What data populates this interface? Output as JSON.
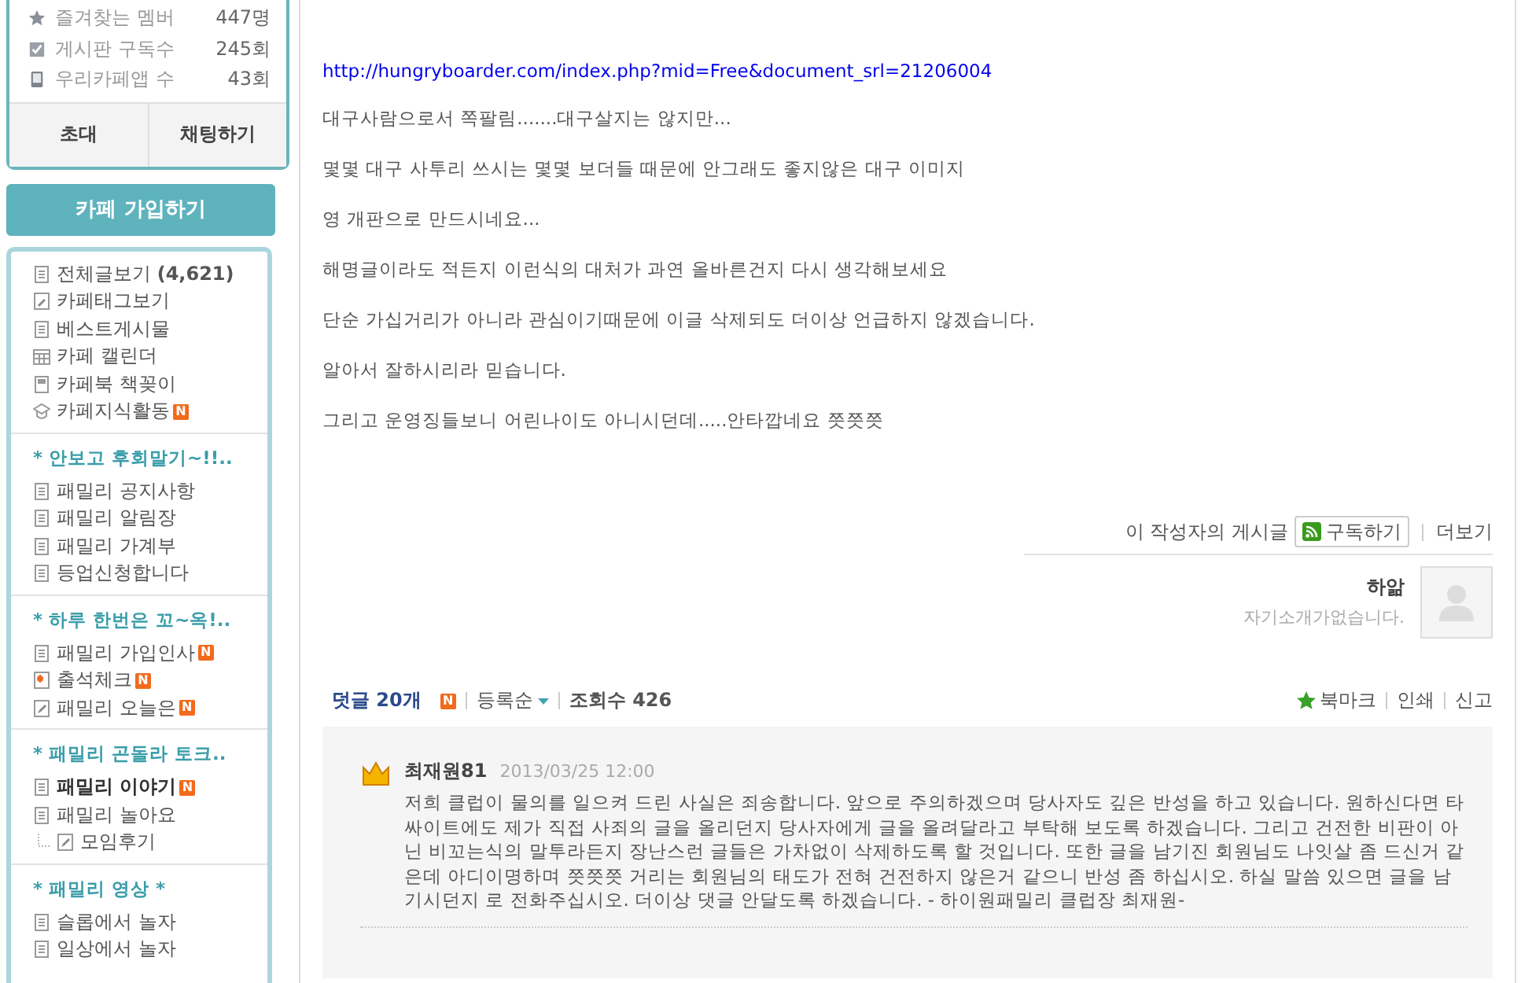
{
  "stats": [
    {
      "kind": "star",
      "label": "즐겨찾는 멤버",
      "value": "447명"
    },
    {
      "kind": "check",
      "label": "게시판 구독수",
      "value": "245회"
    },
    {
      "kind": "phone",
      "label": "우리카페앱 수",
      "value": "43회"
    }
  ],
  "stat_buttons": [
    "초대",
    "채팅하기"
  ],
  "join_button": "카페 가입하기",
  "menu_groups": [
    {
      "items": [
        {
          "kind": "list",
          "label": "전체글보기 **(4,621)**",
          "selected": false
        },
        {
          "kind": "tag",
          "label": "카페태그보기",
          "selected": false
        },
        {
          "kind": "list",
          "label": "베스트게시물",
          "selected": false
        },
        {
          "kind": "calendar",
          "label": "카페 캘린더",
          "selected": false
        },
        {
          "kind": "book",
          "label": "카페북 책꽂이",
          "selected": false
        },
        {
          "kind": "cap",
          "label": "카페지식활동",
          "badge": "N",
          "selected": false
        }
      ]
    },
    {
      "title": "* 안보고 후회말기~!!..",
      "items": [
        {
          "kind": "list",
          "label": "패밀리 공지사항",
          "selected": false
        },
        {
          "kind": "list",
          "label": "패밀리 알림장",
          "selected": false
        },
        {
          "kind": "list",
          "label": "패밀리 가계부",
          "selected": false
        },
        {
          "kind": "list",
          "label": "등업신청합니다",
          "selected": false
        }
      ]
    },
    {
      "title": "* 하루 한번은 꼬~옥!..",
      "items": [
        {
          "kind": "list",
          "label": "패밀리 가입인사",
          "badge": "N",
          "selected": false
        },
        {
          "kind": "attendance",
          "label": "출석체크",
          "badge": "N",
          "selected": false
        },
        {
          "kind": "pencil",
          "label": "패밀리 오늘은",
          "badge": "N",
          "selected": false
        }
      ]
    },
    {
      "title": "* 패밀리 곤돌라 토크..",
      "items": [
        {
          "kind": "list",
          "label": "패밀리 이야기",
          "badge": "N",
          "selected": true
        },
        {
          "kind": "list",
          "label": "패밀리 놀아요",
          "selected": false,
          "children": [
            {
              "kind": "pencil",
              "label": "모임후기",
              "selected": false
            }
          ]
        }
      ]
    },
    {
      "title": "* 패밀리 영상 *",
      "items": [
        {
          "kind": "list",
          "label": "슬롭에서 놀자",
          "selected": false
        },
        {
          "kind": "list",
          "label": "일상에서 놀자",
          "selected": false
        }
      ]
    }
  ],
  "post": {
    "link": "http://hungryboarder.com/index.php?mid=Free&document_srl=21206004",
    "paragraphs": [
      "대구사람으로서 쪽팔림.......대구살지는 않지만...",
      "몇몇 대구 사투리 쓰시는 몇몇 보더들 때문에 안그래도 좋지않은 대구 이미지",
      "영 개판으로 만드시네요...",
      "해명글이라도 적든지 이런식의 대처가 과연 올바른건지 다시 생각해보세요",
      "단순 가십거리가 아니라 관심이기때문에 이글 삭제되도 더이상 언급하지 않겠습니다.",
      "알아서 잘하시리라 믿습니다.",
      "그리고 운영징들보니 어린나이도 아니시던데.....안타깝네요 쯧쯧쯧"
    ]
  },
  "author_bar": {
    "label": "이 작성자의 게시글",
    "subscribe": "구독하기",
    "more": "더보기"
  },
  "author": {
    "name": "하앎",
    "intro": "자기소개가없습니다."
  },
  "comments_bar": {
    "comments": "덧글 20개",
    "badge": "N",
    "sort": "등록순",
    "views": "조회수 426",
    "actions": [
      "북마크",
      "인쇄",
      "신고"
    ]
  },
  "comments": [
    {
      "name": "최재원81",
      "date": "2013/03/25 12:00",
      "text": "저희 클럽이 물의를 일으켜 드린 사실은 죄송합니다. 앞으로 주의하겠으며 당사자도 깊은 반성을 하고 있습니다. 원하신다면 타 싸이트에도 제가 직접 사죄의 글을 올리던지 당사자에게 글을 올려달라고 부탁해 보도록 하겠습니다. 그리고 건전한 비판이 아닌 비꼬는식의 말투라든지 장난스런 글들은 가차없이 삭제하도록 할 것입니다. 또한 글을 남기진 회원님도 나잇살 좀 드신거 같은데 아디이명하며 쯧쯧쯧 거리는 회원님의 태도가 전혀 건전하지 않은거 같으니 반성 좀 하십시오. 하실 말씀 있으면 글을 남기시던지 로 전화주십시오. 더이상 댓글 안달도록 하겠습니다. - 하이원패밀리 클럽장 최재원-"
    }
  ]
}
